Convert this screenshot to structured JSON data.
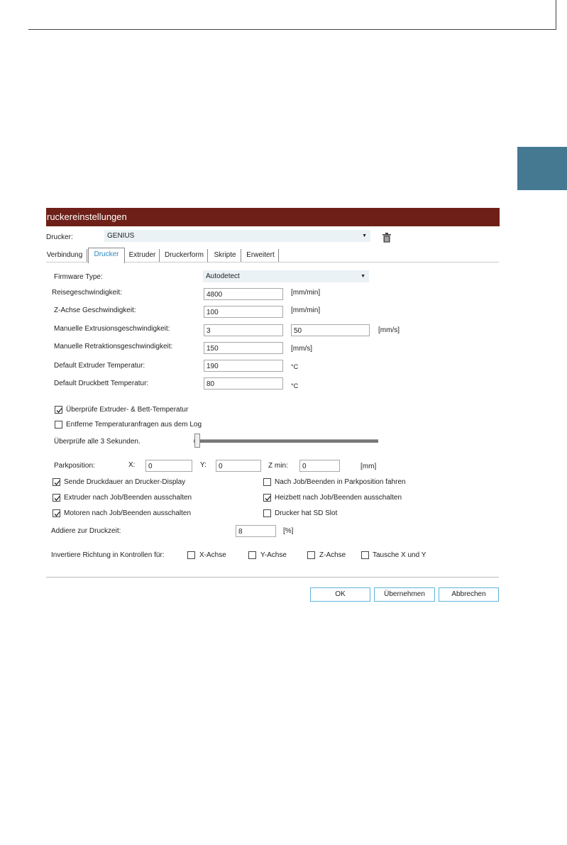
{
  "colors": {
    "title_bar": "#6e2018",
    "side_tab": "#457891",
    "selected_combo": "#eaf2f6",
    "active_tab_text": "#2a8bc0",
    "button_border": "#5fb3d8"
  },
  "dialog": {
    "title": "ruckereinstellungen",
    "printer_label": "Drucker:",
    "printer_value": "GENIUS",
    "delete_icon": "trash-icon",
    "tabs": [
      {
        "label": "Verbindung"
      },
      {
        "label": "Drucker"
      },
      {
        "label": "Extruder"
      },
      {
        "label": "Druckerform"
      },
      {
        "label": "Skripte"
      },
      {
        "label": "Erweitert"
      }
    ],
    "firmware": {
      "label": "Firmware Type:",
      "value": "Autodetect"
    },
    "travel_speed": {
      "label": "Reisegeschwindigkeit:",
      "value": "4800",
      "unit": "[mm/min]"
    },
    "z_speed": {
      "label": "Z-Achse Geschwindigkeit:",
      "value": "100",
      "unit": "[mm/min]"
    },
    "extrusion_speed": {
      "label": "Manuelle Extrusionsgeschwindigkeit:",
      "value1": "3",
      "value2": "50",
      "unit": "[mm/s]"
    },
    "retraction_speed": {
      "label": "Manuelle Retraktionsgeschwindigkeit:",
      "value": "150",
      "unit": "[mm/s]"
    },
    "extruder_temp": {
      "label": "Default Extruder Temperatur:",
      "value": "190",
      "unit": "°C"
    },
    "bed_temp": {
      "label": "Default Druckbett Temperatur:",
      "value": "80",
      "unit": "°C"
    },
    "check_temp": {
      "label": "Überprüfe Extruder- & Bett-Temperatur",
      "checked": true
    },
    "remove_temp_log": {
      "label": "Entferne Temperaturanfragen aus dem Log",
      "checked": false
    },
    "check_interval": {
      "label": "Überprüfe alle 3 Sekunden.",
      "slider_fraction": 0.02
    },
    "park": {
      "label": "Parkposition:",
      "x_label": "X:",
      "x": "0",
      "y_label": "Y:",
      "y": "0",
      "zmin_label": "Z min:",
      "zmin": "0",
      "unit": "[mm]"
    },
    "send_duration": {
      "label": "Sende Druckdauer an Drucker-Display",
      "checked": true
    },
    "park_after_job": {
      "label": "Nach Job/Beenden in Parkposition fahren",
      "checked": false
    },
    "extruder_off": {
      "label": "Extruder nach Job/Beenden ausschalten",
      "checked": true
    },
    "bed_off": {
      "label": "Heizbett nach Job/Beenden ausschalten",
      "checked": true
    },
    "motors_off": {
      "label": "Motoren nach Job/Beenden ausschalten",
      "checked": true
    },
    "sd_slot": {
      "label": "Drucker hat SD Slot",
      "checked": false
    },
    "add_print_time": {
      "label": "Addiere zur Druckzeit:",
      "value": "8",
      "unit": "[%]"
    },
    "invert": {
      "label": "Invertiere Richtung in Kontrollen für:",
      "x": "X-Achse",
      "y": "Y-Achse",
      "z": "Z-Achse",
      "swap": "Tausche X und Y"
    },
    "buttons": {
      "ok": "OK",
      "apply": "Übernehmen",
      "cancel": "Abbrechen"
    }
  }
}
